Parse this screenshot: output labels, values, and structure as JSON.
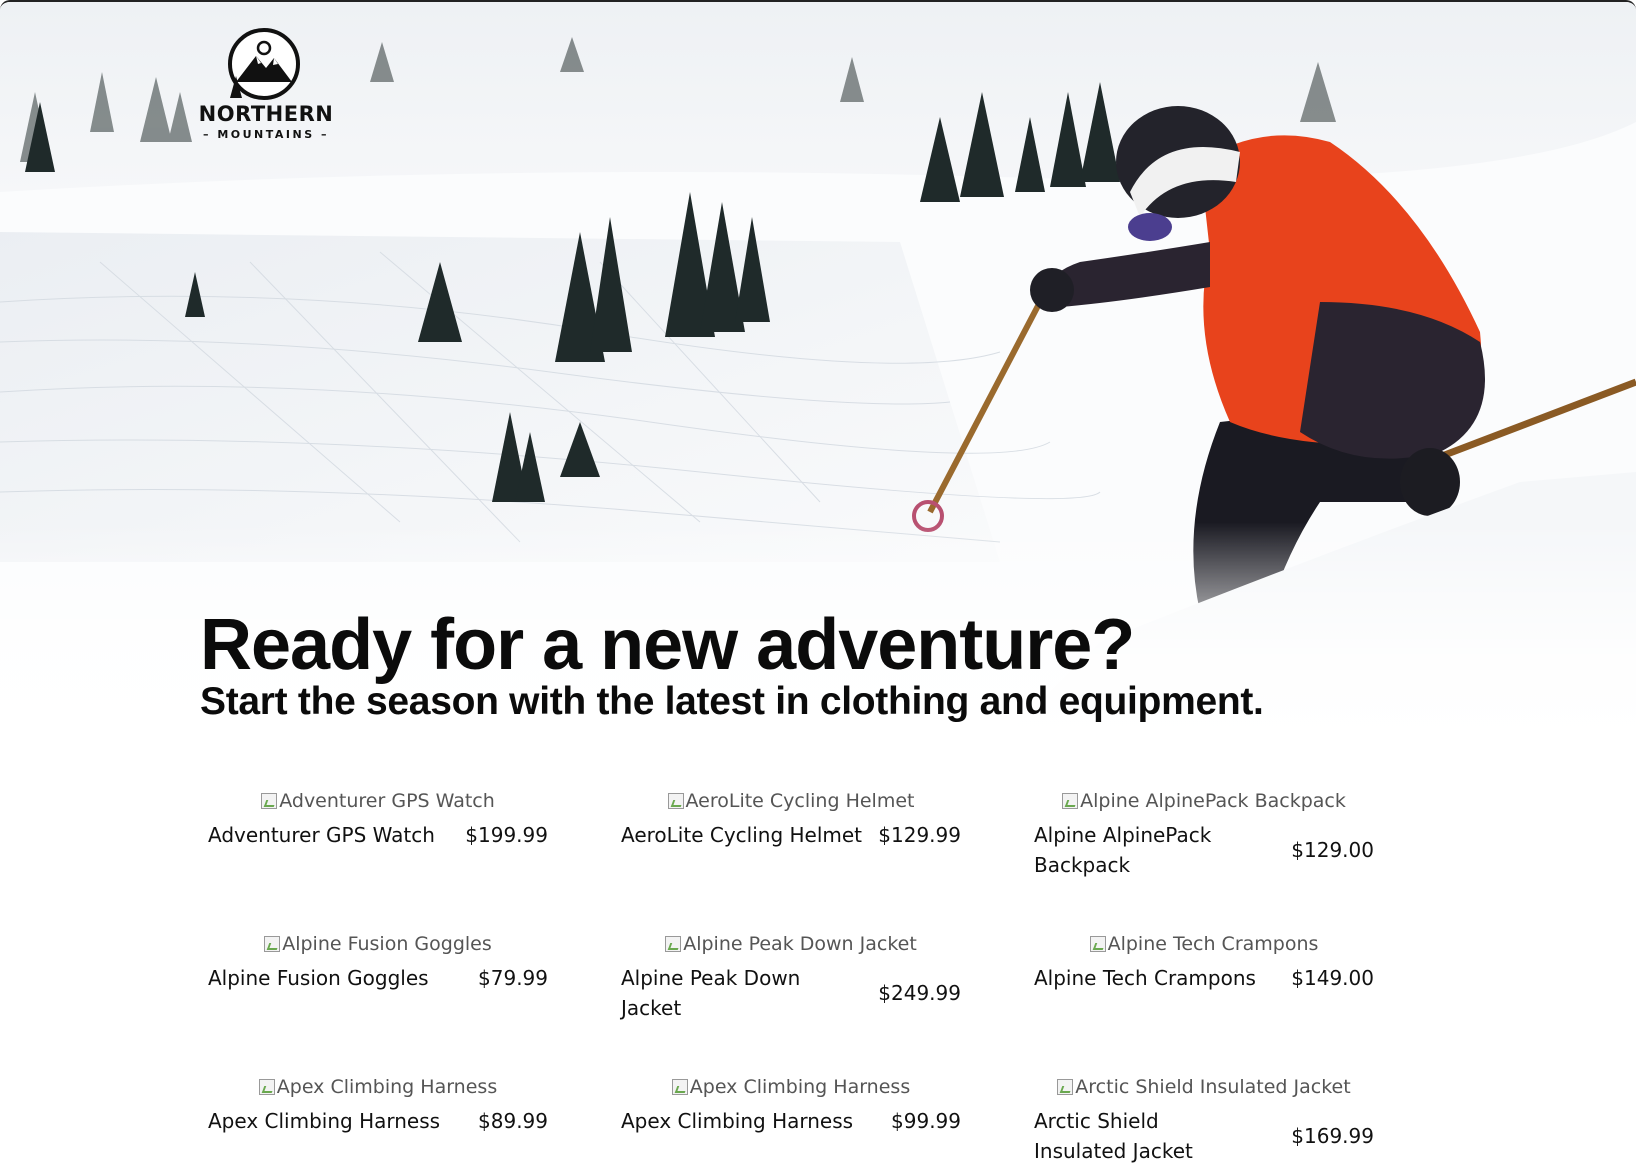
{
  "brand": {
    "name_line1": "NORTHERN",
    "name_line2": "MOUNTAINS"
  },
  "hero": {
    "headline": "Ready for a new adventure?",
    "subheadline": "Start the season with the latest in clothing and equipment."
  },
  "products": [
    {
      "alt": "Adventurer GPS Watch",
      "name": "Adventurer GPS Watch",
      "price": "$199.99"
    },
    {
      "alt": "AeroLite Cycling Helmet",
      "name": "AeroLite Cycling Helmet",
      "price": "$129.99"
    },
    {
      "alt": "Alpine AlpinePack Backpack",
      "name": "Alpine AlpinePack Backpack",
      "price": "$129.00"
    },
    {
      "alt": "Alpine Fusion Goggles",
      "name": "Alpine Fusion Goggles",
      "price": "$79.99"
    },
    {
      "alt": "Alpine Peak Down Jacket",
      "name": "Alpine Peak Down Jacket",
      "price": "$249.99"
    },
    {
      "alt": "Alpine Tech Crampons",
      "name": "Alpine Tech Crampons",
      "price": "$149.00"
    },
    {
      "alt": "Apex Climbing Harness",
      "name": "Apex Climbing Harness",
      "price": "$89.99"
    },
    {
      "alt": "Apex Climbing Harness",
      "name": "Apex Climbing Harness",
      "price": "$99.99"
    },
    {
      "alt": "Arctic Shield Insulated Jacket",
      "name": "Arctic Shield Insulated Jacket",
      "price": "$169.99"
    }
  ],
  "colors": {
    "jacket": "#e8431c",
    "snow": "#f4f6f8",
    "trees": "#1f2a2a",
    "text": "#0b0b0b"
  }
}
